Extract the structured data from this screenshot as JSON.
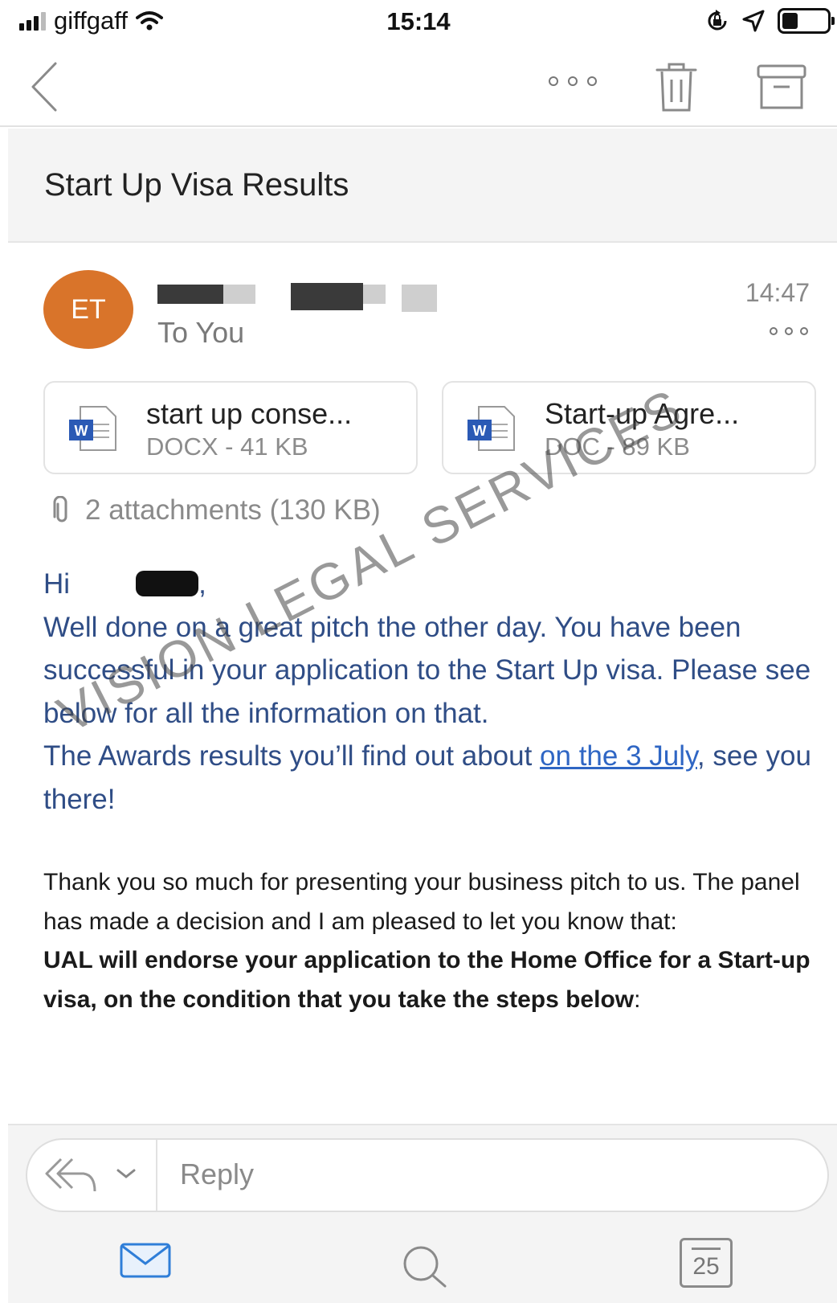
{
  "status_bar": {
    "carrier": "giffgaff",
    "time": "15:14",
    "battery_level": 0.35
  },
  "nav": {
    "back_icon": "chevron-left-icon",
    "more_icon": "ellipsis-icon",
    "delete_icon": "trash-icon",
    "archive_icon": "archive-icon"
  },
  "email": {
    "subject": "Start Up Visa Results",
    "avatar_initials": "ET",
    "avatar_color": "#d9742a",
    "recipient": "To You",
    "time": "14:47",
    "attachments": [
      {
        "name": "start up conse...",
        "meta": "DOCX - 41 KB",
        "icon": "word-doc-icon"
      },
      {
        "name": "Start-up Agre...",
        "meta": "DOC - 89 KB",
        "icon": "word-doc-icon"
      }
    ],
    "attachments_summary": "2 attachments (130 KB)",
    "body": {
      "greeting_start": "Hi",
      "greeting_end": ",",
      "para1": "Well done on a great pitch the other day. You have been successful in your application to the Start Up visa. Please see below for all the information on that.",
      "para2_before_link": "The Awards results you’ll find out about ",
      "para2_link": "on the 3 July",
      "para2_after_link": ", see you there!",
      "para3": "Thank you so much for presenting your business pitch to us. The panel has made a decision and I am pleased to let you know that:",
      "para4_bold": "UAL will endorse your application to the Home Office for a Start-up visa, on the condition that you take the steps below",
      "para4_end": ":"
    }
  },
  "watermark": "VISION LEGAL SERVICES",
  "reply": {
    "placeholder": "Reply"
  },
  "tabbar": {
    "mail_icon": "mail-icon",
    "search_icon": "search-icon",
    "calendar_day": "25",
    "accent": "#2f7ed8"
  }
}
